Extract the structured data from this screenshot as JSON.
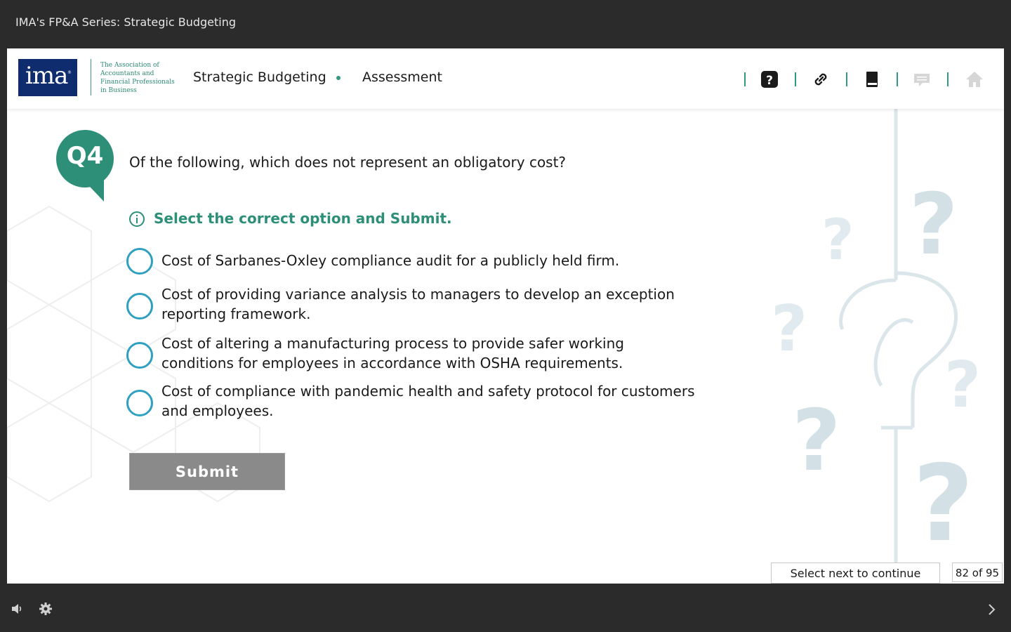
{
  "window": {
    "title": "IMA's FP&A Series: Strategic Budgeting"
  },
  "header": {
    "logo_text": "ima",
    "logo_mark": "®",
    "logo_tagline": [
      "The Association of",
      "Accountants and",
      "Financial Professionals",
      "in Business"
    ],
    "breadcrumb": [
      "Strategic Budgeting",
      "Assessment"
    ],
    "tools": [
      "help-icon",
      "link-icon",
      "book-icon",
      "comment-icon",
      "home-icon"
    ]
  },
  "question": {
    "number": "Q4",
    "text": "Of the following, which does not represent an obligatory cost?",
    "instruction": "Select the correct option and Submit.",
    "options": [
      "Cost of Sarbanes-Oxley compliance audit for a publicly held firm.",
      "Cost of providing variance analysis to managers to develop an exception reporting framework.",
      "Cost of altering a manufacturing process to provide safer working conditions for employees in accordance with OSHA requirements.",
      "Cost of compliance with pandemic health and safety protocol for customers and employees."
    ],
    "submit_label": "Submit"
  },
  "footer": {
    "next_hint": "Select next to continue",
    "page_count": "82 of 95"
  },
  "colors": {
    "accent": "#2e8f78",
    "radio": "#2fa0c0",
    "logo_bg": "#0f2d6e",
    "submit_bg": "#8a8a8a",
    "chrome": "#2b2b2b"
  }
}
